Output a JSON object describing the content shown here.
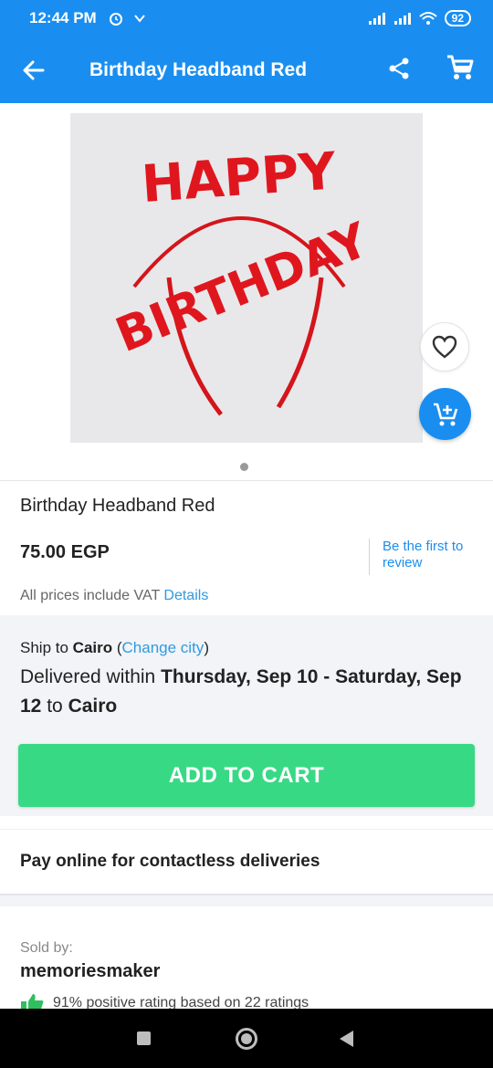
{
  "status_bar": {
    "time": "12:44 PM",
    "battery": "92",
    "icons": [
      "alarm-icon",
      "nfc-icon",
      "signal-icon",
      "signal-icon",
      "wifi-icon",
      "battery-icon"
    ]
  },
  "app_bar": {
    "title": "Birthday Headband Red",
    "icons": [
      "back-arrow-icon",
      "share-icon",
      "cart-icon"
    ],
    "color": "#1a8ef0"
  },
  "gallery": {
    "image_text": [
      "HAPPY",
      "BIRTHDAY"
    ],
    "page_indicator": {
      "current": 1,
      "total": 1
    }
  },
  "product": {
    "name": "Birthday Headband Red",
    "price": "75.00 EGP",
    "review_link": "Be the first to review",
    "vat_text": "All prices include VAT",
    "vat_link": "Details"
  },
  "delivery": {
    "ship_to_label": "Ship to",
    "city": "Cairo",
    "change_city": "Change city",
    "delivered_within": "Delivered within",
    "date_range": "Thursday, Sep 10 - Saturday, Sep 12",
    "to": "to",
    "dest_city": "Cairo"
  },
  "actions": {
    "add_to_cart": "ADD TO CART",
    "button_color": "#38d985"
  },
  "promo": {
    "text": "Pay online for contactless deliveries"
  },
  "seller": {
    "sold_by_label": "Sold by:",
    "name": "memoriesmaker",
    "rating_text": "91% positive rating based on 22 ratings"
  }
}
